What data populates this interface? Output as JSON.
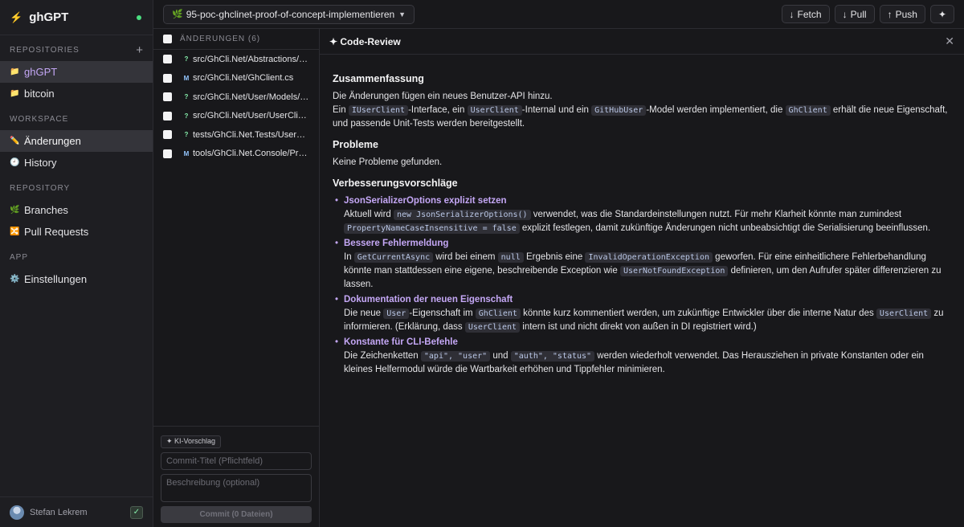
{
  "app": {
    "name": "ghGPT"
  },
  "sidebar": {
    "sections": [
      {
        "label": "REPOSITORIES",
        "items": [
          {
            "icon": "folder-icon",
            "label": "ghGPT",
            "active": true
          },
          {
            "icon": "folder-icon",
            "label": "bitcoin"
          }
        ]
      },
      {
        "label": "WORKSPACE",
        "items": [
          {
            "icon": "pencil-icon",
            "label": "Änderungen",
            "active": true
          },
          {
            "icon": "clock-icon",
            "label": "History"
          }
        ]
      },
      {
        "label": "REPOSITORY",
        "items": [
          {
            "icon": "branch-icon",
            "label": "Branches"
          },
          {
            "icon": "pull-request-icon",
            "label": "Pull Requests"
          }
        ]
      },
      {
        "label": "APP",
        "items": [
          {
            "icon": "gear-icon",
            "label": "Einstellungen"
          }
        ]
      }
    ],
    "user": {
      "name": "Stefan Lekrem"
    }
  },
  "topbar": {
    "branch": "95-poc-ghclinet-proof-of-concept-implementieren",
    "fetch": "Fetch",
    "pull": "Pull",
    "push": "Push",
    "sparkle": "✦"
  },
  "changes": {
    "header": "ÄNDERUNGEN (6)",
    "files": [
      {
        "status": "?",
        "path": "src/GhCli.Net/Abstractions/IUserClient.cs"
      },
      {
        "status": "M",
        "path": "src/GhCli.Net/GhClient.cs"
      },
      {
        "status": "?",
        "path": "src/GhCli.Net/User/Models/GitHubUser.cs"
      },
      {
        "status": "?",
        "path": "src/GhCli.Net/User/UserClient.cs"
      },
      {
        "status": "?",
        "path": "tests/GhCli.Net.Tests/UserClientTests.cs"
      },
      {
        "status": "M",
        "path": "tools/GhCli.Net.Console/Program.cs"
      }
    ]
  },
  "commit": {
    "ai_suggest": "✦ KI-Vorschlag",
    "title_placeholder": "Commit-Titel (Pflichtfeld)",
    "desc_placeholder": "Beschreibung (optional)",
    "button": "Commit (0 Dateien)"
  },
  "review": {
    "title": "✦ Code-Review",
    "summary_heading": "Zusammenfassung",
    "summary_line1": "Die Änderungen fügen ein neues Benutzer-API hinzu.",
    "problems_heading": "Probleme",
    "problems_text": "Keine Probleme gefunden.",
    "suggestions_heading": "Verbesserungsvorschläge",
    "suggestions": [
      {
        "title": "JsonSerializerOptions explizit setzen"
      },
      {
        "title": "Bessere Fehlermeldung"
      },
      {
        "title": "Dokumentation der neuen Eigenschaft"
      },
      {
        "title": "Konstante für CLI-Befehle"
      }
    ]
  }
}
